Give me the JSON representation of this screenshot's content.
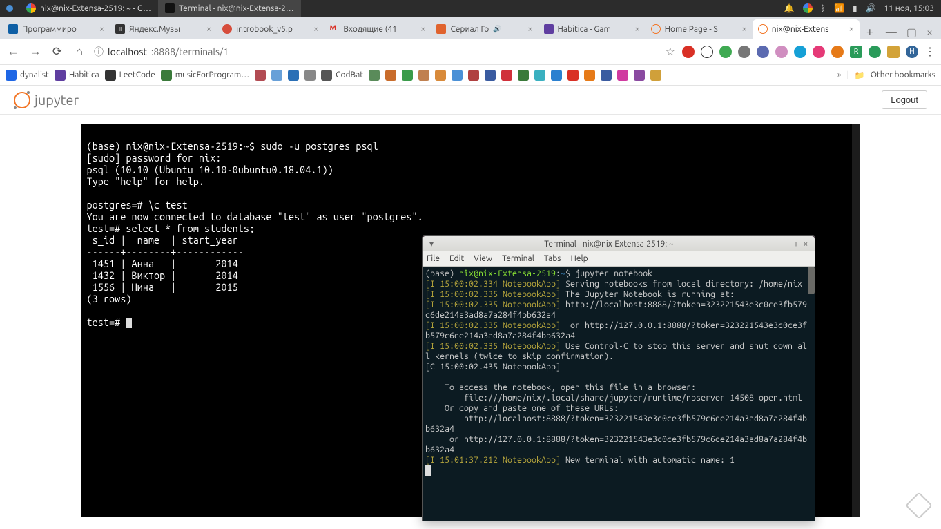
{
  "os_bar": {
    "tasks": [
      {
        "label": "nix@nix-Extensa-2519: ~ - G…",
        "icon_color": "linear-gradient(#ea4335 0 25%,#fbbc05 0 50%,#34a853 0 75%,#4285f4 0)"
      },
      {
        "label": "Terminal - nix@nix-Extensa-2…",
        "icon_color": "#111"
      }
    ],
    "clock": "11 ноя, 15:03"
  },
  "tabs": [
    {
      "label": "Программиро",
      "fav": "#0e5fa5",
      "active": false
    },
    {
      "label": "Яндекс.Музы",
      "fav": "#333",
      "active": false
    },
    {
      "label": "introbook_v5.p",
      "fav": "#d64d3c",
      "active": false
    },
    {
      "label": "Входящие (41",
      "fav": "#d93025",
      "active": false,
      "prefix": "M"
    },
    {
      "label": "Сериал Го",
      "fav": "#e0632e",
      "active": false,
      "audio": true
    },
    {
      "label": "Habitica - Gam",
      "fav": "#5f3ea0",
      "active": false
    },
    {
      "label": "Home Page - S",
      "fav": "#f37626",
      "active": false
    },
    {
      "label": "nix@nix-Extens",
      "fav": "#f37626",
      "active": true
    }
  ],
  "url": {
    "scheme": "ⓘ",
    "host": "localhost",
    "rest": ":8888/terminals/1"
  },
  "ext_colors": [
    "#d93025",
    "#222",
    "#3faa52",
    "#777",
    "#5b6ab0",
    "#d08ec0",
    "#16a0d6",
    "#e53a77",
    "#e67a18",
    "#2a9b5a",
    "#2a9b5a",
    "#d3a339",
    "#369"
  ],
  "bookmarks": [
    {
      "label": "dynalist",
      "color": "#1e66e5"
    },
    {
      "label": "Habitica",
      "color": "#5f3ea0"
    },
    {
      "label": "LeetCode",
      "color": "#333"
    },
    {
      "label": "musicForProgram…",
      "color": "#3a7a3a"
    },
    {
      "label": "",
      "color": "#b24b53"
    },
    {
      "label": "",
      "color": "#68a0d8"
    },
    {
      "label": "",
      "color": "#2a6fb6"
    },
    {
      "label": "",
      "color": "#888"
    },
    {
      "label": "CodBat",
      "color": "#555"
    }
  ],
  "bm_icon_colors": [
    "#5a8b5a",
    "#c96c2b",
    "#3a9b4a",
    "#c08050",
    "#d88a3a",
    "#4a90d6",
    "#b04040",
    "#3a5ba0",
    "#d0303a",
    "#3a7a3a",
    "#3ab0c0",
    "#2a80d0",
    "#d93025",
    "#e67a18",
    "#3a5ba0",
    "#d03aa0",
    "#8a4aa0",
    "#d0a03a"
  ],
  "other_bookmarks": "Other bookmarks",
  "jupyter": {
    "logo_text": "jupyter",
    "logout": "Logout"
  },
  "psql": {
    "line1": "(base) nix@nix-Extensa-2519:~$ sudo -u postgres psql",
    "line2": "[sudo] password for nix: ",
    "line3": "psql (10.10 (Ubuntu 10.10-0ubuntu0.18.04.1))",
    "line4": "Type \"help\" for help.",
    "line5": "",
    "line6": "postgres=# \\c test",
    "line7": "You are now connected to database \"test\" as user \"postgres\".",
    "line8": "test=# select * from students;",
    "hdr": " s_id |  name  | start_year ",
    "sep": "------+--------+------------",
    "row1": " 1451 | Анна   |       2014",
    "row2": " 1432 | Виктор |       2014",
    "row3": " 1556 | Нина   |       2015",
    "rows": "(3 rows)",
    "blank": "",
    "prompt": "test=# "
  },
  "native_terminal": {
    "title": "Terminal - nix@nix-Extensa-2519: ~",
    "menu": [
      "File",
      "Edit",
      "View",
      "Terminal",
      "Tabs",
      "Help"
    ],
    "p_user": "nix@nix-Extensa-2519",
    "p_path": "~",
    "p_cmd": "jupyter notebook",
    "ts1": "[I 15:00:02.334 NotebookApp]",
    "ts2": "[I 15:00:02.335 NotebookApp]",
    "tsC": "[C 15:00:02.435 NotebookApp]",
    "ts3": "[I 15:01:37.212 NotebookApp]",
    "m1": " Serving notebooks from local directory: /home/nix",
    "m2": " The Jupyter Notebook is running at:",
    "m3": " http://localhost:8888/?token=323221543e3c0ce3fb579c6de214a3ad8a7a284f4bb632a4",
    "m4": "  or http://127.0.0.1:8888/?token=323221543e3c0ce3fb579c6de214a3ad8a7a284f4bb632a4",
    "m5": " Use Control-C to stop this server and shut down all kernels (twice to skip confirmation).",
    "b1": "",
    "b2": "    To access the notebook, open this file in a browser:",
    "b3": "        file:///home/nix/.local/share/jupyter/runtime/nbserver-14508-open.html",
    "b4": "    Or copy and paste one of these URLs:",
    "b5": "        http://localhost:8888/?token=323221543e3c0ce3fb579c6de214a3ad8a7a284f4bb632a4",
    "b6": "     or http://127.0.0.1:8888/?token=323221543e3c0ce3fb579c6de214a3ad8a7a284f4bb632a4",
    "m6": " New terminal with automatic name: 1"
  }
}
